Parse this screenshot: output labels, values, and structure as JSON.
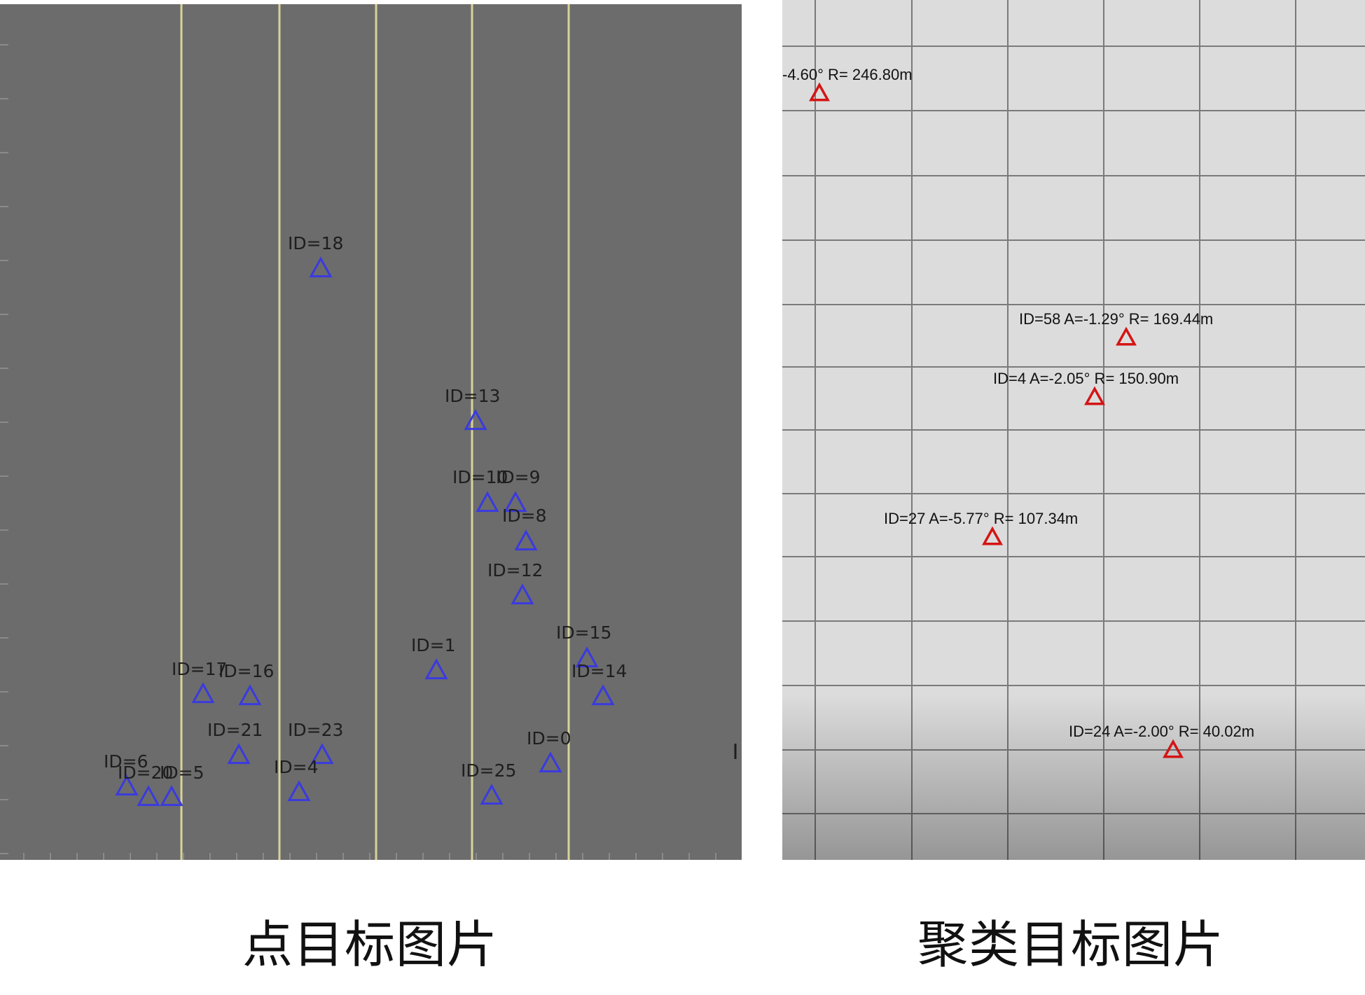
{
  "colors": {
    "left_background": "#6c6c6c",
    "lane_line": "#d6d39a",
    "point_marker": "#3a3ae0",
    "point_label": "#1e1e1e",
    "right_background": "#dcdcdc",
    "grid_line": "#7a7a7a",
    "cluster_marker": "#d41414",
    "cluster_label": "#111111"
  },
  "icons": {
    "point_marker": "blue-triangle-icon",
    "cluster_marker": "red-triangle-icon"
  },
  "point_targets": {
    "caption": "点目标图片",
    "targets": [
      {
        "label": "ID=18"
      },
      {
        "label": "ID=13"
      },
      {
        "label": "ID=10"
      },
      {
        "label": "ID=9"
      },
      {
        "label": "ID=8"
      },
      {
        "label": "ID=12"
      },
      {
        "label": "ID=1"
      },
      {
        "label": "ID=15"
      },
      {
        "label": "ID=14"
      },
      {
        "label": "ID=17"
      },
      {
        "label": "ID=16"
      },
      {
        "label": "ID=21"
      },
      {
        "label": "ID=23"
      },
      {
        "label": "ID=0"
      },
      {
        "label": "ID=6"
      },
      {
        "label": "ID=4"
      },
      {
        "label": "ID=25"
      },
      {
        "label": "ID=20"
      },
      {
        "label": "ID=5"
      }
    ]
  },
  "cluster_targets": {
    "caption": "聚类目标图片",
    "targets": [
      {
        "label": "-4.60° R= 246.80m"
      },
      {
        "label": "ID=58 A=-1.29° R= 169.44m"
      },
      {
        "label": "ID=4 A=-2.05° R= 150.90m"
      },
      {
        "label": "ID=27 A=-5.77° R= 107.34m"
      },
      {
        "label": "ID=24 A=-2.00° R= 40.02m"
      }
    ]
  }
}
